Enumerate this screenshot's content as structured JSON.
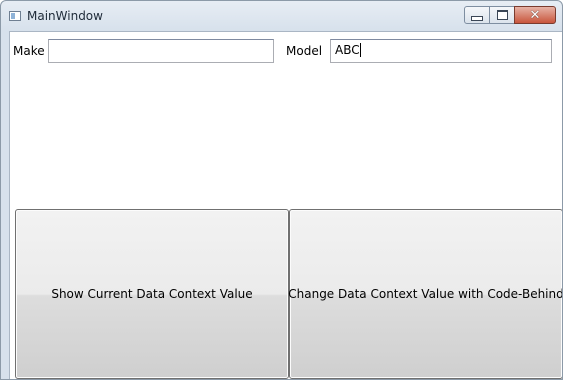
{
  "window": {
    "title": "MainWindow",
    "icon": "window-app-icon"
  },
  "caption_buttons": {
    "minimize_icon": "minimize-icon",
    "maximize_icon": "maximize-icon",
    "close_icon": "close-icon",
    "close_glyph": "✕"
  },
  "form": {
    "make_label": "Make",
    "make_value": "",
    "model_label": "Model",
    "model_value": "ABC"
  },
  "buttons": {
    "show_value_label": "Show Current Data Context Value",
    "change_value_label": "Change Data Context Value with Code-Behind"
  },
  "colors": {
    "close_button": "#c8553c",
    "button_border": "#707070",
    "textbox_border": "#abadb3"
  }
}
